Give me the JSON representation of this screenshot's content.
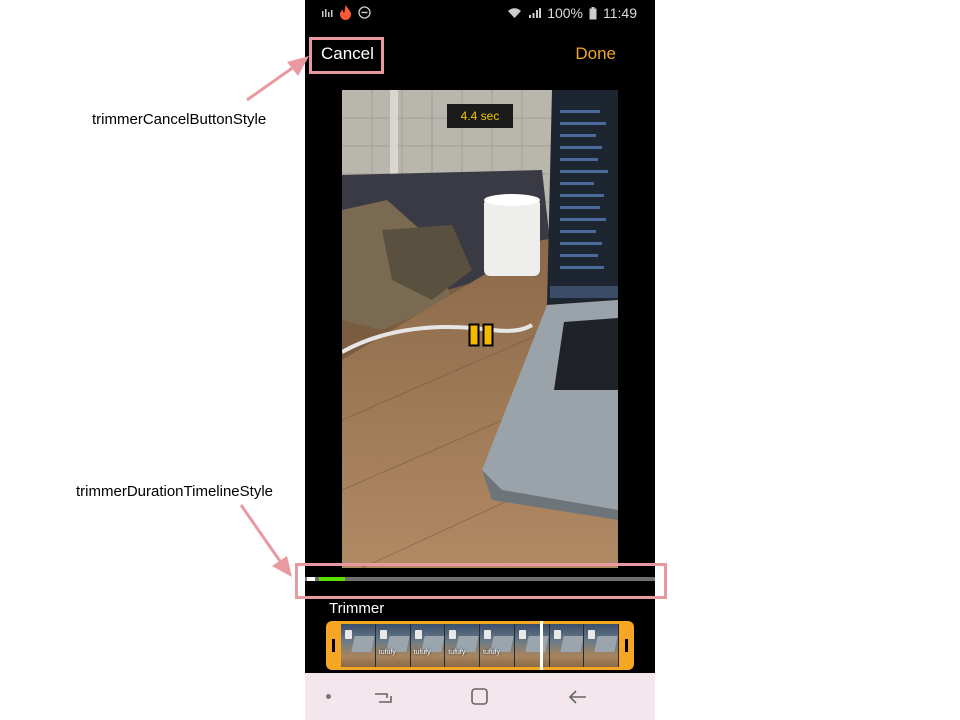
{
  "annotations": {
    "cancel_style": "trimmerCancelButtonStyle",
    "timeline_style": "trimmerDurationTimelineStyle"
  },
  "status_bar": {
    "battery": "100%",
    "time": "11:49"
  },
  "header": {
    "cancel_label": "Cancel",
    "done_label": "Done"
  },
  "video": {
    "duration": "4.4 sec",
    "playback_state": "paused-control-visible"
  },
  "timeline": {
    "progress": 0.07
  },
  "trimmer": {
    "label": "Trimmer",
    "frame_brand": "tufufy",
    "frame_count": 8
  },
  "colors": {
    "accent": "#f5a623",
    "duration_text": "#f5c400",
    "progress": "#5be000",
    "annotation": "#e99aa0",
    "nav_bg": "#f3e6ec"
  },
  "icons": [
    "wifi-icon",
    "signal-icon",
    "battery-icon",
    "tinder-flame-icon",
    "do-not-disturb-icon",
    "pause-icon",
    "recent-apps-icon",
    "home-icon",
    "back-icon"
  ]
}
